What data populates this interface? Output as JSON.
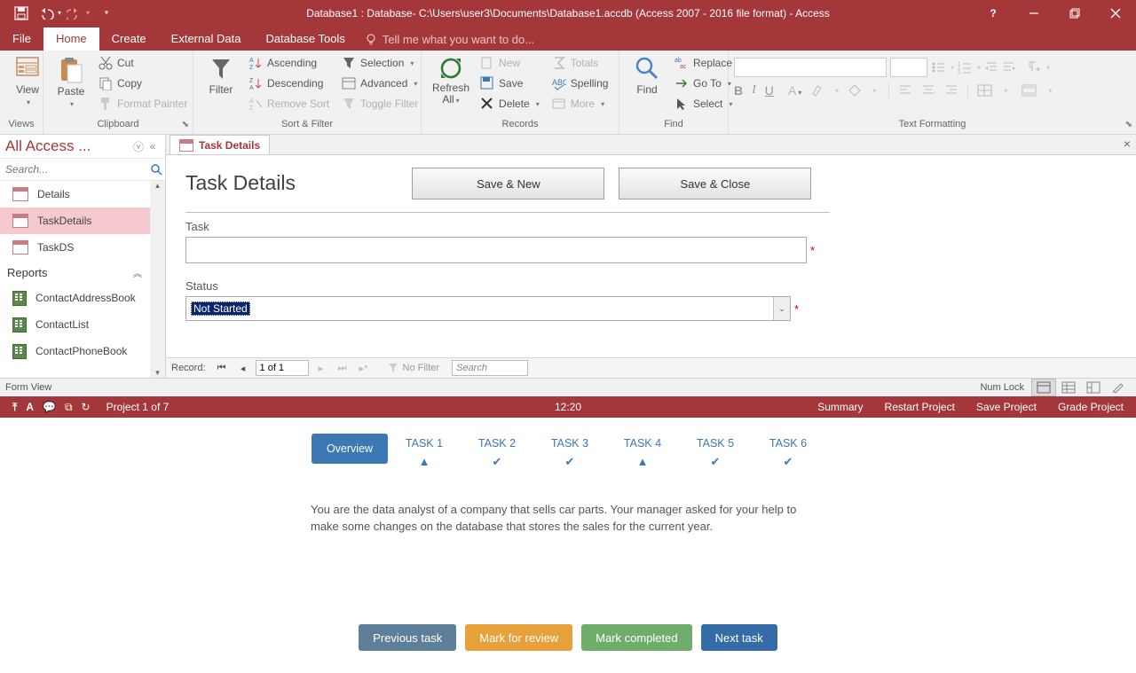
{
  "title": "Database1 : Database- C:\\Users\\user3\\Documents\\Database1.accdb (Access 2007 - 2016 file format) - Access",
  "menu": {
    "file": "File",
    "home": "Home",
    "create": "Create",
    "external": "External Data",
    "tools": "Database Tools",
    "tellme": "Tell me what you want to do..."
  },
  "ribbon": {
    "views": {
      "label": "Views",
      "view": "View"
    },
    "clipboard": {
      "label": "Clipboard",
      "paste": "Paste",
      "cut": "Cut",
      "copy": "Copy",
      "painter": "Format Painter"
    },
    "sortfilter": {
      "label": "Sort & Filter",
      "filter": "Filter",
      "asc": "Ascending",
      "desc": "Descending",
      "remove": "Remove Sort",
      "selection": "Selection",
      "advanced": "Advanced",
      "toggle": "Toggle Filter"
    },
    "records": {
      "label": "Records",
      "refresh": "Refresh\nAll",
      "new": "New",
      "save": "Save",
      "delete": "Delete",
      "totals": "Totals",
      "spelling": "Spelling",
      "more": "More"
    },
    "find": {
      "label": "Find",
      "find": "Find",
      "replace": "Replace",
      "goto": "Go To",
      "select": "Select"
    },
    "textfmt": {
      "label": "Text Formatting"
    }
  },
  "nav": {
    "title": "All Access ...",
    "search": "Search...",
    "items": [
      "Details",
      "TaskDetails",
      "TaskDS"
    ],
    "reportsLabel": "Reports",
    "reports": [
      "ContactAddressBook",
      "ContactList",
      "ContactPhoneBook"
    ]
  },
  "doc": {
    "tab": "Task Details",
    "heading": "Task Details",
    "saveNew": "Save & New",
    "saveClose": "Save & Close",
    "taskLabel": "Task",
    "statusLabel": "Status",
    "statusValue": "Not Started"
  },
  "recnav": {
    "label": "Record:",
    "pos": "1 of 1",
    "nofilter": "No Filter",
    "search": "Search"
  },
  "status": {
    "left": "Form View",
    "numlock": "Num Lock"
  },
  "trainer": {
    "project": "Project 1 of 7",
    "time": "12:20",
    "links": [
      "Summary",
      "Restart Project",
      "Save Project",
      "Grade Project"
    ],
    "tabs": [
      "Overview",
      "TASK 1",
      "TASK 2",
      "TASK 3",
      "TASK 4",
      "TASK 5",
      "TASK 6"
    ],
    "indicators": [
      "",
      "warn",
      "ok",
      "ok",
      "warn",
      "ok",
      "ok"
    ],
    "desc": "You are the data analyst of a company that sells car parts. Your manager asked for your help to make some changes on the database that stores the sales for the current year.",
    "btns": {
      "prev": "Previous task",
      "mark": "Mark for review",
      "done": "Mark completed",
      "next": "Next task"
    }
  }
}
